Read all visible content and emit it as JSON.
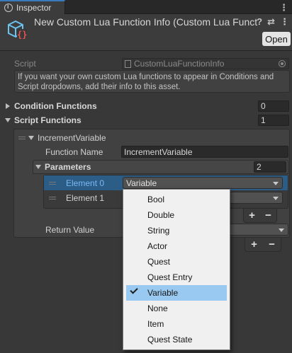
{
  "tab": {
    "title": "Inspector"
  },
  "header": {
    "title": "New Custom Lua Function Info (Custom Lua Funct",
    "open_label": "Open"
  },
  "script": {
    "label": "Script",
    "value": "CustomLuaFunctionInfo"
  },
  "help_text": "If you want your own custom Lua functions to appear in Conditions and Script dropdowns, add their info to this asset.",
  "condition_functions": {
    "label": "Condition Functions",
    "count": "0"
  },
  "script_functions": {
    "label": "Script Functions",
    "count": "1"
  },
  "function": {
    "header": "IncrementVariable",
    "name_label": "Function Name",
    "name_value": "IncrementVariable",
    "parameters_label": "Parameters",
    "parameters_count": "2",
    "elements": [
      {
        "label": "Element 0",
        "value": "Variable"
      },
      {
        "label": "Element 1",
        "value": ""
      }
    ],
    "return_label": "Return Value",
    "return_value": ""
  },
  "buttons": {
    "plus": "+",
    "minus": "−"
  },
  "dropdown_menu": {
    "items": [
      "Bool",
      "Double",
      "String",
      "Actor",
      "Quest",
      "Quest Entry",
      "Variable",
      "None",
      "Item",
      "Quest State"
    ],
    "selected": "Variable"
  },
  "colors": {
    "accent_tab": "#3a79bb",
    "selected_row": "#2c5d87",
    "menu_highlight": "#99c9f0"
  }
}
